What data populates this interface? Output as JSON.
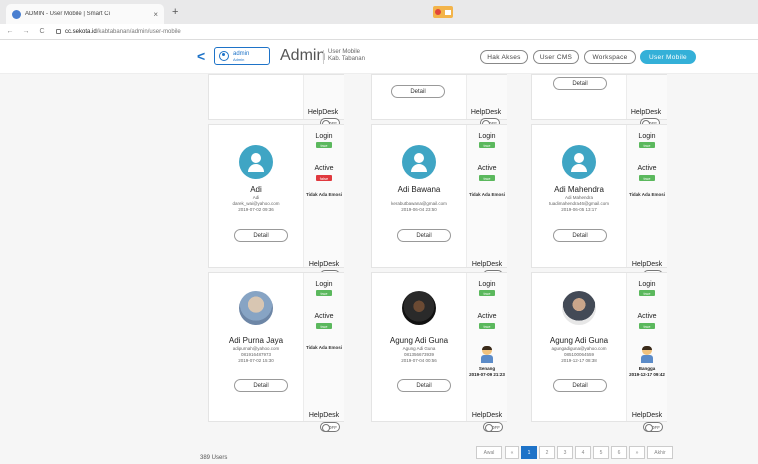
{
  "browser": {
    "tab_title": "ADMIN - User Mobile | Smart Ci",
    "tab_close": "×",
    "new_tab": "+",
    "url_host": "cc.sekota.id",
    "url_path": "/kabtabanan/admin/user-mobile"
  },
  "header": {
    "user_name": "admin",
    "user_role": "Admin",
    "title": "Admin",
    "subtitle_line1": "User Mobile",
    "subtitle_line2": "Kab. Tabanan",
    "menu": [
      {
        "label": "Hak Akses",
        "active": false
      },
      {
        "label": "User CMS",
        "active": false
      },
      {
        "label": "Workspace",
        "active": false
      },
      {
        "label": "User Mobile",
        "active": true
      }
    ]
  },
  "labels": {
    "detail": "Detail",
    "helpdesk": "HelpDesk",
    "login": "Login",
    "active": "Active",
    "off": "OFF",
    "no_emotion": "Tidak Ada Emosi"
  },
  "cards_top": [
    {
      "name": "Adi",
      "line1": "Adi",
      "email": "darek_wai@yahoo.com",
      "date": "2019-07-02 09:36",
      "login": "true",
      "active": "false",
      "emotion": "Tidak Ada Emosi"
    },
    {
      "name": "Adi Bawana",
      "line1": "",
      "email": "kerabutbawana@gmail.com",
      "date": "2019-06-04 23:50",
      "login": "true",
      "active": "true",
      "emotion": "Tidak Ada Emosi"
    },
    {
      "name": "Adi Mahendra",
      "line1": "Adi Mahendra",
      "email": "tuadimahendra46@gmail.com",
      "date": "2019-06-05 13:17",
      "login": "true",
      "active": "true",
      "emotion": "Tidak Ada Emosi"
    }
  ],
  "cards_bottom": [
    {
      "name": "Adi Purna Jaya",
      "line1": "adipurnah@yahoo.com",
      "email": "081916487973",
      "date": "2019-07-02 15:30",
      "login": "true",
      "active": "true",
      "emotion": "Tidak Ada Emosi"
    },
    {
      "name": "Agung Adi Guna",
      "line1": "Agung Adi Guna",
      "email": "081356673939",
      "date": "2019-07-04 00:56",
      "login": "true",
      "active": "true",
      "emotion": "Senang",
      "emotion_date": "2019-07-09 21:23"
    },
    {
      "name": "Agung Adi Guna",
      "line1": "agungadiguna@yahoo.com",
      "email": "085100064559",
      "date": "2019-12-17 08:38",
      "login": "true",
      "active": "true",
      "emotion": "Bangga",
      "emotion_date": "2019-12-17 09:42"
    }
  ],
  "footer": {
    "count": "389 Users",
    "pages": [
      "Awal",
      "«",
      "1",
      "2",
      "3",
      "4",
      "5",
      "6",
      "»",
      "Akhir"
    ]
  },
  "colors": {
    "accent": "#1e73c8",
    "active_menu": "#34b0d8",
    "true_badge": "#5bb85d",
    "false_badge": "#e0393e"
  }
}
